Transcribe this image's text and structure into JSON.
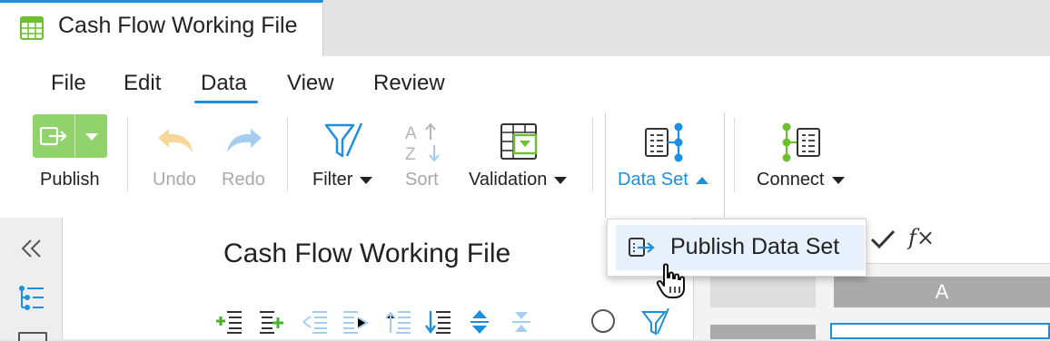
{
  "document_tab": {
    "title": "Cash Flow Working File",
    "icon": "spreadsheet-icon"
  },
  "menu": {
    "items": [
      "File",
      "Edit",
      "Data",
      "View",
      "Review"
    ],
    "active": "Data"
  },
  "toolbar": {
    "publish": {
      "label": "Publish",
      "icon": "publish-icon"
    },
    "undo": {
      "label": "Undo",
      "icon": "undo-icon",
      "enabled": false
    },
    "redo": {
      "label": "Redo",
      "icon": "redo-icon",
      "enabled": false
    },
    "filter": {
      "label": "Filter",
      "icon": "filter-icon"
    },
    "sort": {
      "label": "Sort",
      "icon": "sort-az-icon",
      "enabled": false
    },
    "validation": {
      "label": "Validation",
      "icon": "validation-icon"
    },
    "data_set": {
      "label": "Data Set",
      "icon": "data-set-icon",
      "open": true
    },
    "connect": {
      "label": "Connect",
      "icon": "connect-icon"
    }
  },
  "dropdown": {
    "items": [
      {
        "label": "Publish Data Set",
        "icon": "publish-data-set-icon"
      }
    ]
  },
  "left_pane": {
    "title": "Cash Flow Working File"
  },
  "formula_bar": {
    "fx_symbol": "f×"
  },
  "grid": {
    "column_header": "A"
  },
  "colors": {
    "accent": "#1e8fde",
    "publish_green": "#8fd36a",
    "connect_green": "#6cbf2e",
    "disabled": "#a9a9a9"
  }
}
